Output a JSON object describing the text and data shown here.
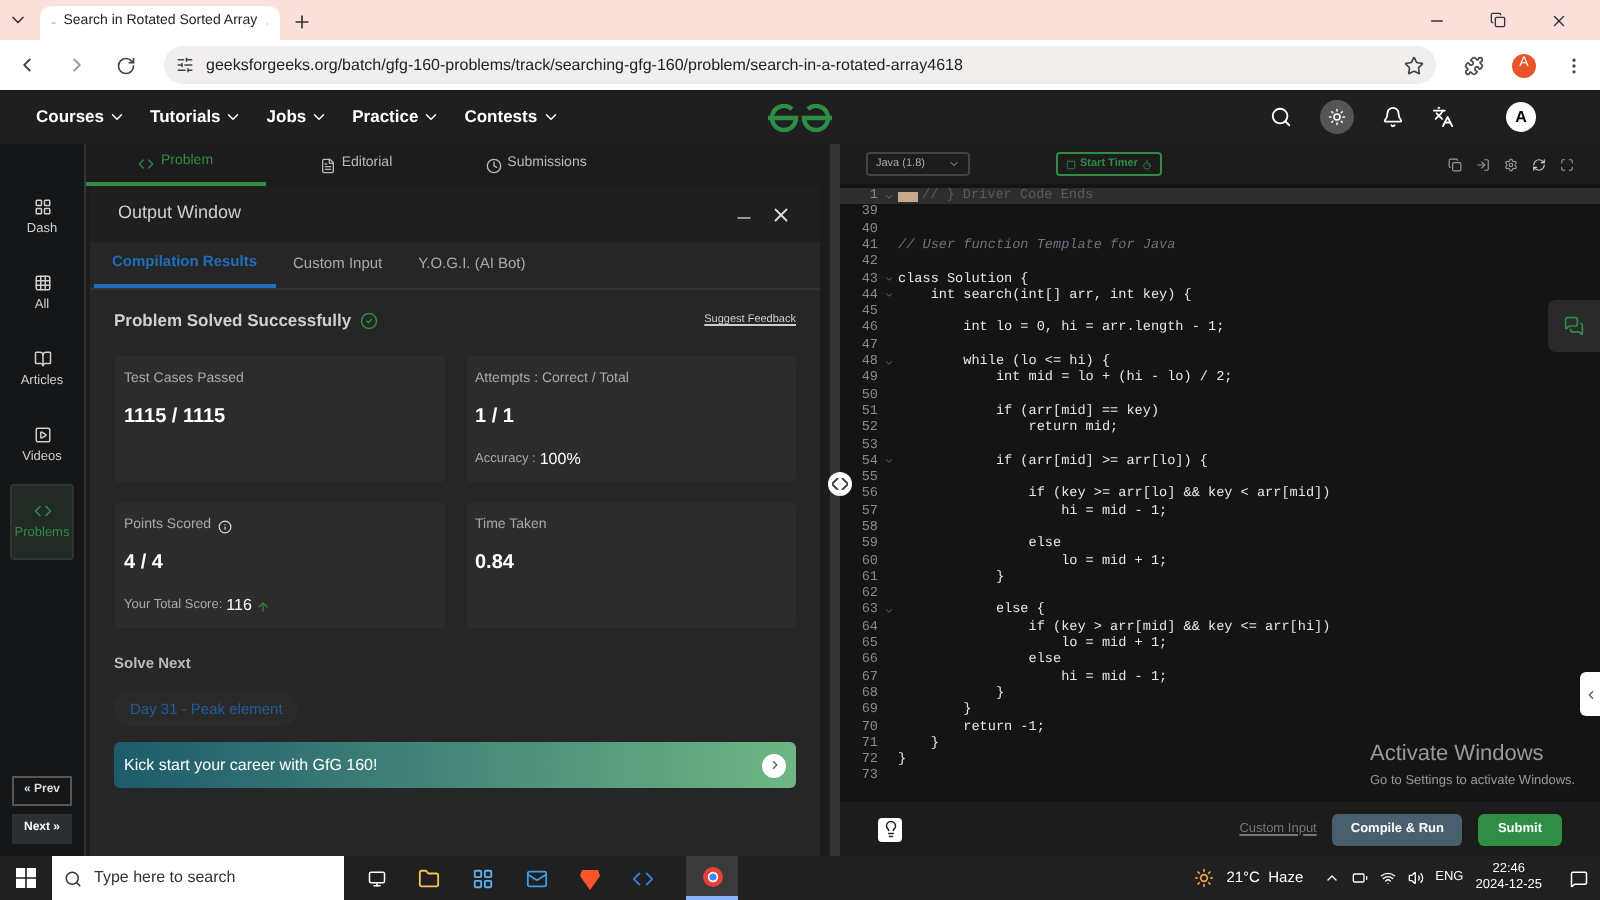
{
  "browser": {
    "tab_title": "Search in Rotated Sorted Array",
    "url": "geeksforgeeks.org/batch/gfg-160-problems/track/searching-gfg-160/problem/search-in-a-rotated-array4618",
    "profile": "A"
  },
  "nav": {
    "menus": [
      "Courses",
      "Tutorials",
      "Jobs",
      "Practice",
      "Contests"
    ],
    "avatar": "A"
  },
  "sidebar": {
    "items": [
      {
        "label": "Dash",
        "selected": false
      },
      {
        "label": "All",
        "selected": false
      },
      {
        "label": "Articles",
        "selected": false
      },
      {
        "label": "Videos",
        "selected": false
      },
      {
        "label": "Problems",
        "selected": true
      }
    ],
    "prev": "« Prev",
    "next": "Next »"
  },
  "problem_tabs": [
    {
      "label": "Problem",
      "selected": true
    },
    {
      "label": "Editorial",
      "selected": false
    },
    {
      "label": "Submissions",
      "selected": false
    }
  ],
  "output_window": {
    "title": "Output Window",
    "tabs": [
      {
        "label": "Compilation Results",
        "selected": true
      },
      {
        "label": "Custom Input",
        "selected": false
      },
      {
        "label": "Y.O.G.I. (AI Bot)",
        "selected": false
      }
    ],
    "status": "Problem Solved Successfully",
    "feedback": "Suggest Feedback",
    "cards": [
      {
        "label": "Test Cases Passed",
        "value": "1115 / 1115"
      },
      {
        "label": "Attempts : Correct / Total",
        "value": "1 / 1",
        "sub_label": "Accuracy :",
        "sub_value": "100%"
      },
      {
        "label": "Points Scored",
        "info": true,
        "value": "4 / 4",
        "sub_label": "Your Total Score:",
        "sub_value": "116",
        "trend_up": true
      },
      {
        "label": "Time Taken",
        "value": "0.84"
      }
    ],
    "solve_next": "Solve Next",
    "next_problem": "Day 31 - Peak element",
    "banner": "Kick start your career with GfG 160!"
  },
  "editor": {
    "language": "Java (1.8)",
    "timer": "Start Timer",
    "lines": [
      {
        "number": "1",
        "kind": "folded",
        "foldable": true,
        "text": "// } Driver Code Ends"
      },
      {
        "number": "39",
        "kind": "code",
        "foldable": false
      },
      {
        "number": "40",
        "kind": "code",
        "foldable": false
      },
      {
        "number": "41",
        "kind": "comment",
        "foldable": false,
        "text": "// User function Template for Java"
      },
      {
        "number": "42",
        "kind": "code",
        "foldable": false
      },
      {
        "number": "43",
        "kind": "code",
        "foldable": true,
        "text": "class Solution {"
      },
      {
        "number": "44",
        "kind": "code",
        "foldable": true,
        "text": "    int search(int[] arr, int key) {"
      },
      {
        "number": "45",
        "kind": "code",
        "foldable": false
      },
      {
        "number": "46",
        "kind": "code",
        "foldable": false,
        "text": "        int lo = 0, hi = arr.length - 1;"
      },
      {
        "number": "47",
        "kind": "code",
        "foldable": false
      },
      {
        "number": "48",
        "kind": "code",
        "foldable": true,
        "text": "        while (lo <= hi) {"
      },
      {
        "number": "49",
        "kind": "code",
        "foldable": false,
        "text": "            int mid = lo + (hi - lo) / 2;"
      },
      {
        "number": "50",
        "kind": "code",
        "foldable": false
      },
      {
        "number": "51",
        "kind": "code",
        "foldable": false,
        "text": "            if (arr[mid] == key)"
      },
      {
        "number": "52",
        "kind": "code",
        "foldable": false,
        "text": "                return mid;"
      },
      {
        "number": "53",
        "kind": "code",
        "foldable": false
      },
      {
        "number": "54",
        "kind": "code",
        "foldable": true,
        "text": "            if (arr[mid] >= arr[lo]) {"
      },
      {
        "number": "55",
        "kind": "code",
        "foldable": false
      },
      {
        "number": "56",
        "kind": "code",
        "foldable": false,
        "text": "                if (key >= arr[lo] && key < arr[mid])"
      },
      {
        "number": "57",
        "kind": "code",
        "foldable": false,
        "text": "                    hi = mid - 1;"
      },
      {
        "number": "58",
        "kind": "code",
        "foldable": false
      },
      {
        "number": "59",
        "kind": "code",
        "foldable": false,
        "text": "                else"
      },
      {
        "number": "60",
        "kind": "code",
        "foldable": false,
        "text": "                    lo = mid + 1;"
      },
      {
        "number": "61",
        "kind": "code",
        "foldable": false,
        "text": "            }"
      },
      {
        "number": "62",
        "kind": "code",
        "foldable": false
      },
      {
        "number": "63",
        "kind": "code",
        "foldable": true,
        "text": "            else {"
      },
      {
        "number": "64",
        "kind": "code",
        "foldable": false,
        "text": "                if (key > arr[mid] && key <= arr[hi])"
      },
      {
        "number": "65",
        "kind": "code",
        "foldable": false,
        "text": "                    lo = mid + 1;"
      },
      {
        "number": "66",
        "kind": "code",
        "foldable": false,
        "text": "                else"
      },
      {
        "number": "67",
        "kind": "code",
        "foldable": false,
        "text": "                    hi = mid - 1;"
      },
      {
        "number": "68",
        "kind": "code",
        "foldable": false,
        "text": "            }"
      },
      {
        "number": "69",
        "kind": "code",
        "foldable": false,
        "text": "        }"
      },
      {
        "number": "70",
        "kind": "code",
        "foldable": false,
        "text": "        return -1;"
      },
      {
        "number": "71",
        "kind": "code",
        "foldable": false,
        "text": "    }"
      },
      {
        "number": "72",
        "kind": "code",
        "foldable": false,
        "text": "}"
      },
      {
        "number": "73",
        "kind": "code",
        "foldable": false
      }
    ],
    "custom_input": "Custom Input",
    "compile": "Compile & Run",
    "submit": "Submit"
  },
  "activation": {
    "title": "Activate Windows",
    "hint": "Go to Settings to activate Windows."
  },
  "taskbar": {
    "search_placeholder": "Type here to search",
    "weather": "21°C  Haze",
    "language": "ENG",
    "time": "22:46",
    "date": "2024-12-25"
  }
}
